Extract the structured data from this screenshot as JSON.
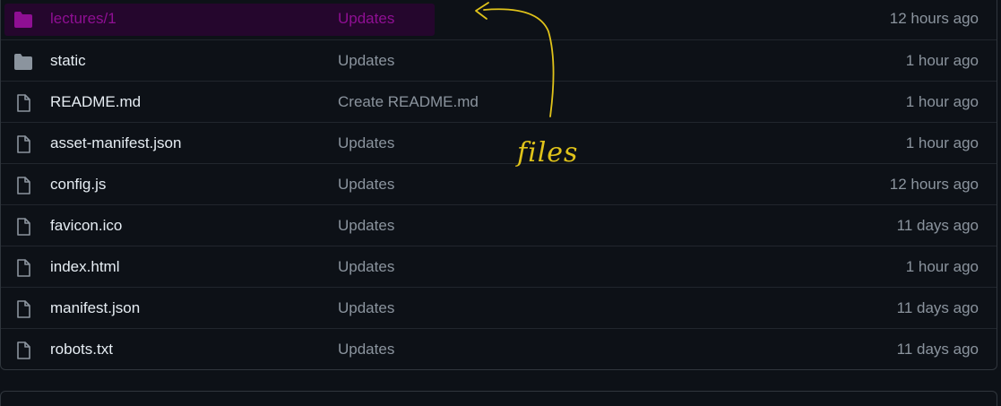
{
  "files": [
    {
      "name": "lectures/1",
      "commit": "Updates",
      "age": "12 hours ago",
      "icon": "folder-icon"
    },
    {
      "name": "static",
      "commit": "Updates",
      "age": "1 hour ago",
      "icon": "folder-icon"
    },
    {
      "name": "README.md",
      "commit": "Create README.md",
      "age": "1 hour ago",
      "icon": "file-icon"
    },
    {
      "name": "asset-manifest.json",
      "commit": "Updates",
      "age": "1 hour ago",
      "icon": "file-icon"
    },
    {
      "name": "config.js",
      "commit": "Updates",
      "age": "12 hours ago",
      "icon": "file-icon"
    },
    {
      "name": "favicon.ico",
      "commit": "Updates",
      "age": "11 days ago",
      "icon": "file-icon"
    },
    {
      "name": "index.html",
      "commit": "Updates",
      "age": "1 hour ago",
      "icon": "file-icon"
    },
    {
      "name": "manifest.json",
      "commit": "Updates",
      "age": "11 days ago",
      "icon": "file-icon"
    },
    {
      "name": "robots.txt",
      "commit": "Updates",
      "age": "11 days ago",
      "icon": "file-icon"
    }
  ],
  "annotation": {
    "text": "files",
    "color": "#e0c31a"
  },
  "colors": {
    "highlight_text": "#8f0f93",
    "highlight_background": "#25062d",
    "folder_gray": "#8b949e"
  }
}
